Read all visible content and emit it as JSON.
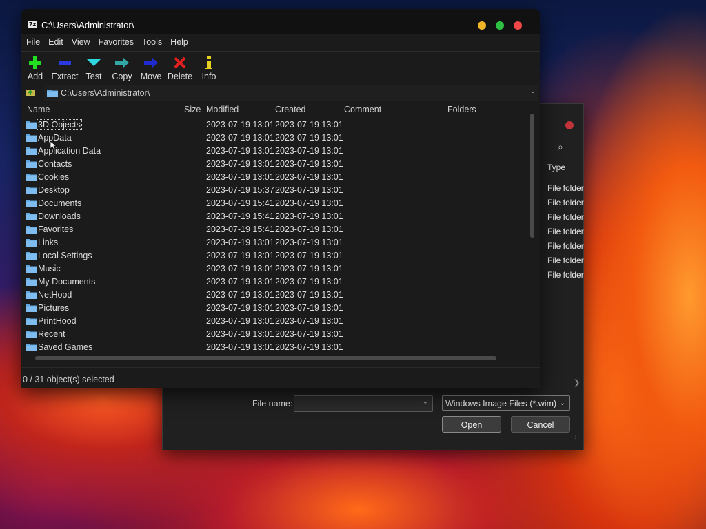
{
  "window": {
    "title": "C:\\Users\\Administrator\\",
    "app_icon": "7z",
    "traffic_lights": {
      "minimize": "#f0b428",
      "maximize": "#2ec042",
      "close": "#f04848"
    }
  },
  "menu": [
    "File",
    "Edit",
    "View",
    "Favorites",
    "Tools",
    "Help"
  ],
  "toolbar": [
    {
      "label": "Add",
      "icon": "plus-icon",
      "color": "#22dd22"
    },
    {
      "label": "Extract",
      "icon": "minus-icon",
      "color": "#2a3ae0"
    },
    {
      "label": "Test",
      "icon": "check-icon",
      "color": "#2fd8e0"
    },
    {
      "label": "Copy",
      "icon": "copy-arrow-icon",
      "color": "#33a6a6"
    },
    {
      "label": "Move",
      "icon": "move-arrow-icon",
      "color": "#1f2ad0"
    },
    {
      "label": "Delete",
      "icon": "x-icon",
      "color": "#e02020"
    },
    {
      "label": "Info",
      "icon": "info-icon",
      "color": "#e8d020"
    }
  ],
  "address": {
    "path": "C:\\Users\\Administrator\\"
  },
  "columns": [
    "Name",
    "Size",
    "Modified",
    "Created",
    "Comment",
    "Folders"
  ],
  "rows": [
    {
      "name": "3D Objects",
      "modified": "2023-07-19 13:01",
      "created": "2023-07-19 13:01"
    },
    {
      "name": "AppData",
      "modified": "2023-07-19 13:01",
      "created": "2023-07-19 13:01"
    },
    {
      "name": "Application Data",
      "modified": "2023-07-19 13:01",
      "created": "2023-07-19 13:01"
    },
    {
      "name": "Contacts",
      "modified": "2023-07-19 13:01",
      "created": "2023-07-19 13:01"
    },
    {
      "name": "Cookies",
      "modified": "2023-07-19 13:01",
      "created": "2023-07-19 13:01"
    },
    {
      "name": "Desktop",
      "modified": "2023-07-19 15:37",
      "created": "2023-07-19 13:01"
    },
    {
      "name": "Documents",
      "modified": "2023-07-19 15:41",
      "created": "2023-07-19 13:01"
    },
    {
      "name": "Downloads",
      "modified": "2023-07-19 15:41",
      "created": "2023-07-19 13:01"
    },
    {
      "name": "Favorites",
      "modified": "2023-07-19 15:41",
      "created": "2023-07-19 13:01"
    },
    {
      "name": "Links",
      "modified": "2023-07-19 13:01",
      "created": "2023-07-19 13:01"
    },
    {
      "name": "Local Settings",
      "modified": "2023-07-19 13:01",
      "created": "2023-07-19 13:01"
    },
    {
      "name": "Music",
      "modified": "2023-07-19 13:01",
      "created": "2023-07-19 13:01"
    },
    {
      "name": "My Documents",
      "modified": "2023-07-19 13:01",
      "created": "2023-07-19 13:01"
    },
    {
      "name": "NetHood",
      "modified": "2023-07-19 13:01",
      "created": "2023-07-19 13:01"
    },
    {
      "name": "Pictures",
      "modified": "2023-07-19 13:01",
      "created": "2023-07-19 13:01"
    },
    {
      "name": "PrintHood",
      "modified": "2023-07-19 13:01",
      "created": "2023-07-19 13:01"
    },
    {
      "name": "Recent",
      "modified": "2023-07-19 13:01",
      "created": "2023-07-19 13:01"
    },
    {
      "name": "Saved Games",
      "modified": "2023-07-19 13:01",
      "created": "2023-07-19 13:01"
    }
  ],
  "status": "0 / 31 object(s) selected",
  "dialog": {
    "type_column": "Type",
    "type_items": [
      "File folder",
      "File folder",
      "File folder",
      "File folder",
      "File folder",
      "File folder",
      "File folder"
    ],
    "file_name_label": "File name:",
    "file_name_value": "",
    "filter": "Windows Image Files (*.wim)",
    "open_label": "Open",
    "cancel_label": "Cancel"
  }
}
